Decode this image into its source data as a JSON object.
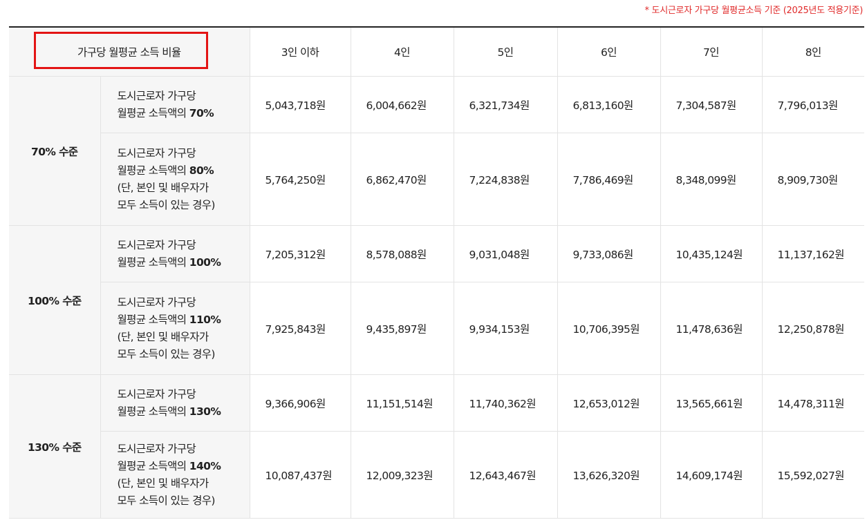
{
  "note": "* 도시근로자 가구당 월평균소득 기준 (2025년도 적용기준)",
  "header": {
    "ratio_label": "가구당 월평균 소득 비율",
    "columns": [
      "3인 이하",
      "4인",
      "5인",
      "6인",
      "7인",
      "8인"
    ]
  },
  "groups": [
    {
      "level": "70% 수준",
      "rows": [
        {
          "desc": "도시근로자 가구당",
          "desc2": "월평균 소득액의 ",
          "pct": "70%",
          "note1": "",
          "note2": "",
          "values": [
            "5,043,718원",
            "6,004,662원",
            "6,321,734원",
            "6,813,160원",
            "7,304,587원",
            "7,796,013원"
          ]
        },
        {
          "desc": "도시근로자 가구당",
          "desc2": "월평균 소득액의 ",
          "pct": "80%",
          "note1": "(단, 본인 및 배우자가",
          "note2": "모두 소득이 있는 경우)",
          "values": [
            "5,764,250원",
            "6,862,470원",
            "7,224,838원",
            "7,786,469원",
            "8,348,099원",
            "8,909,730원"
          ]
        }
      ]
    },
    {
      "level": "100% 수준",
      "rows": [
        {
          "desc": "도시근로자 가구당",
          "desc2": "월평균 소득액의 ",
          "pct": "100%",
          "note1": "",
          "note2": "",
          "values": [
            "7,205,312원",
            "8,578,088원",
            "9,031,048원",
            "9,733,086원",
            "10,435,124원",
            "11,137,162원"
          ]
        },
        {
          "desc": "도시근로자 가구당",
          "desc2": "월평균 소득액의 ",
          "pct": "110%",
          "note1": "(단, 본인 및 배우자가",
          "note2": "모두 소득이 있는 경우)",
          "values": [
            "7,925,843원",
            "9,435,897원",
            "9,934,153원",
            "10,706,395원",
            "11,478,636원",
            "12,250,878원"
          ]
        }
      ]
    },
    {
      "level": "130% 수준",
      "rows": [
        {
          "desc": "도시근로자 가구당",
          "desc2": "월평균 소득액의 ",
          "pct": "130%",
          "note1": "",
          "note2": "",
          "values": [
            "9,366,906원",
            "11,151,514원",
            "11,740,362원",
            "12,653,012원",
            "13,565,661원",
            "14,478,311원"
          ]
        },
        {
          "desc": "도시근로자 가구당",
          "desc2": "월평균 소득액의 ",
          "pct": "140%",
          "note1": "(단, 본인 및 배우자가",
          "note2": "모두 소득이 있는 경우)",
          "values": [
            "10,087,437원",
            "12,009,323원",
            "12,643,467원",
            "13,626,320원",
            "14,609,174원",
            "15,592,027원"
          ]
        }
      ]
    }
  ],
  "colors": {
    "note": "#e02a2a",
    "highlight_box": "#e31414",
    "header_bg": "#f6f6f6"
  }
}
